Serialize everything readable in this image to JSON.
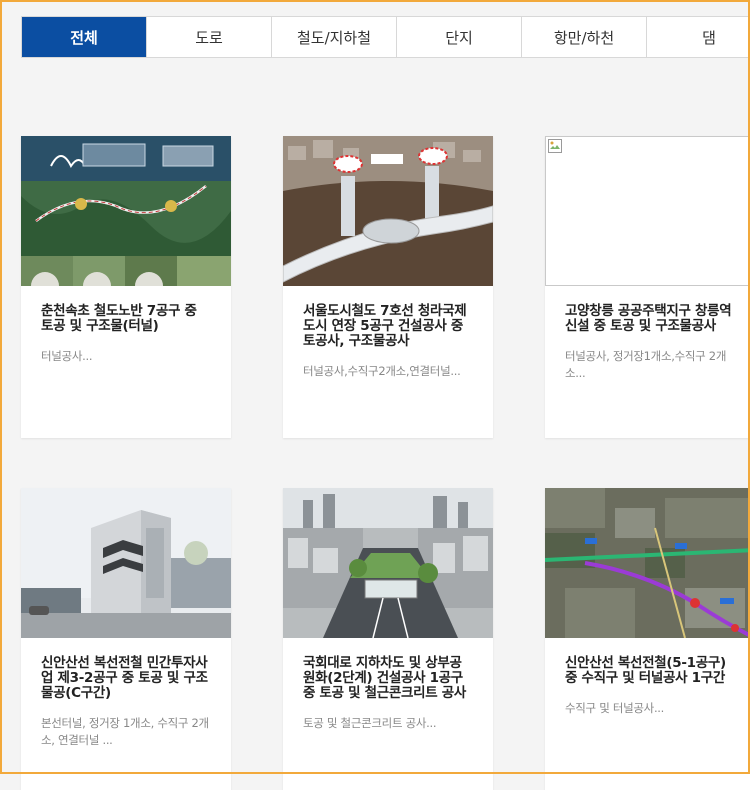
{
  "tabs": [
    {
      "label": "전체",
      "active": true
    },
    {
      "label": "도로",
      "active": false
    },
    {
      "label": "철도/지하철",
      "active": false
    },
    {
      "label": "단지",
      "active": false
    },
    {
      "label": "항만/하천",
      "active": false
    },
    {
      "label": "댐",
      "active": false
    }
  ],
  "cards": [
    {
      "title": "춘천속초 철도노반 7공구 중 토공 및 구조물(터널)",
      "desc": "터널공사...",
      "image": "railway-tunnel-aerial-map"
    },
    {
      "title": "서울도시철도 7호선 청라국제도시 연장 5공구 건설공사 중 토공사, 구조물공사",
      "desc": "터널공사,수직구2개소,연결터널...",
      "image": "subway-tunnel-3d-render"
    },
    {
      "title": "고양창릉 공공주택지구 창릉역 신설 중 토공 및 구조물공사",
      "desc": "터널공사, 정거장1개소,수직구 2개소...",
      "image": "broken-image"
    },
    {
      "title": "신안산선 복선전철 민간투자사업 제3-2공구 중 토공 및 구조물공(C구간)",
      "desc": "본선터널, 정거장 1개소, 수직구 2개소, 연결터널 ...",
      "image": "building-rendering"
    },
    {
      "title": "국회대로 지하차도 및 상부공원화(2단계) 건설공사 1공구 중 토공 및 철근콘크리트 공사",
      "desc": "토공 및 철근콘크리트 공사...",
      "image": "underpass-park-rendering"
    },
    {
      "title": "신안산선 복선전철(5-1공구) 중 수직구 및 터널공사 1구간",
      "desc": "수직구 및 터널공사...",
      "image": "satellite-route-map"
    }
  ]
}
